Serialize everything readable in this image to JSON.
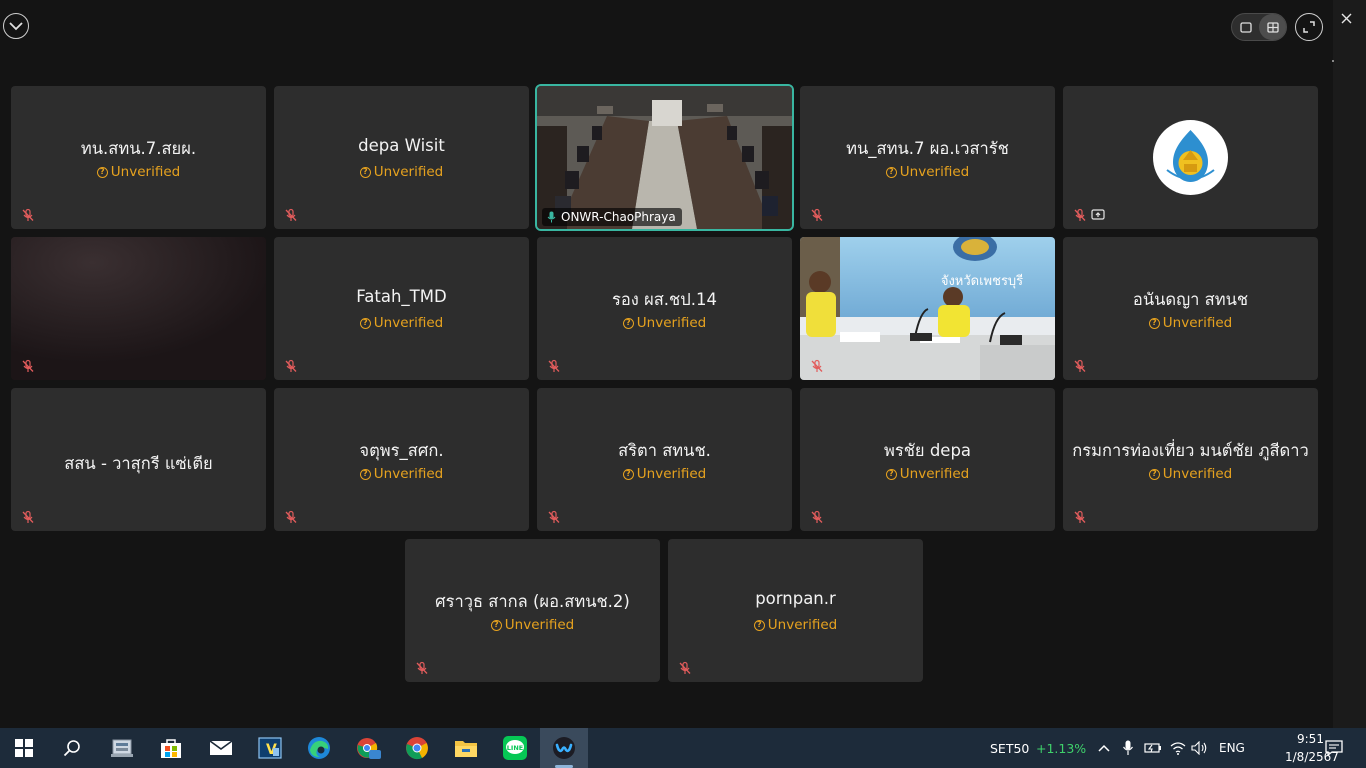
{
  "header": {
    "collapse_icon": "chevron-down-icon",
    "layout_single_icon": "single-view-icon",
    "layout_grid_icon": "grid-view-icon",
    "fullscreen_icon": "fullscreen-icon",
    "close_icon": "close-icon"
  },
  "status_label": "Unverified",
  "participants": [
    {
      "name": "ทน.สทน.7.สยผ.",
      "status": "Unverified"
    },
    {
      "name": "depa Wisit",
      "status": "Unverified"
    },
    {
      "name": "ONWR-ChaoPhraya",
      "video": "meeting-room"
    },
    {
      "name": "ทน_สทน.7 ผอ.เวสารัช",
      "status": "Unverified"
    },
    {
      "name": "",
      "avatar": "emblem"
    },
    {
      "name": "",
      "video": "dark"
    },
    {
      "name": "Fatah_TMD",
      "status": "Unverified"
    },
    {
      "name": "รอง ผส.ชป.14",
      "status": "Unverified"
    },
    {
      "name": "",
      "video": "office",
      "sign_text": "จังหวัดเพชรบุรี"
    },
    {
      "name": "อนันดญา สทนช",
      "status": "Unverified"
    },
    {
      "name": "สสน - วาสุกรี แซ่เตีย",
      "status": ""
    },
    {
      "name": "จตุพร_สศก.",
      "status": "Unverified"
    },
    {
      "name": "สริตา สทนช.",
      "status": "Unverified"
    },
    {
      "name": "พรชัย depa",
      "status": "Unverified"
    },
    {
      "name": "กรมการท่องเที่ยว มนต์ชัย ภูสีดาว",
      "status": "Unverified"
    },
    {
      "name": "ศราวุธ  สากล (ผอ.สทนช.2)",
      "status": "Unverified"
    },
    {
      "name": "pornpan.r",
      "status": "Unverified"
    }
  ],
  "taskbar": {
    "apps": [
      "windows-start-icon",
      "search-icon",
      "task-view-icon",
      "store-icon",
      "mail-icon",
      "vnc-icon",
      "edge-icon",
      "chrome-profile-icon",
      "chrome-icon",
      "file-explorer-icon",
      "line-icon",
      "webex-icon"
    ],
    "ticker_symbol": "SET50",
    "ticker_change": "+1.13%",
    "language": "ENG",
    "time": "9:51",
    "date": "1/8/2567"
  },
  "colors": {
    "unverified": "#e6a21f",
    "active_speaker": "#39b6a1",
    "ticker_up": "#3fd16b"
  }
}
